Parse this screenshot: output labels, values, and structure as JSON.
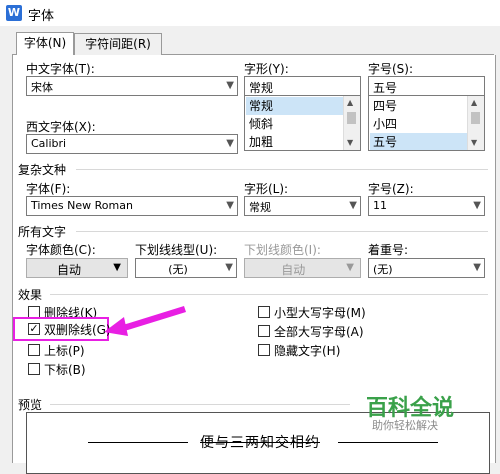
{
  "window": {
    "title": "字体",
    "app_icon": "W"
  },
  "tabs": [
    {
      "label": "字体(N)"
    },
    {
      "label": "字符间距(R)"
    }
  ],
  "chinese_font": {
    "label": "中文字体(T):",
    "value": "宋体"
  },
  "western_font": {
    "label": "西文字体(X):",
    "value": "Calibri"
  },
  "style": {
    "label": "字形(Y):",
    "value": "常规",
    "options": [
      "常规",
      "倾斜",
      "加粗"
    ],
    "selected": "常规"
  },
  "size": {
    "label": "字号(S):",
    "value": "五号",
    "options": [
      "四号",
      "小四",
      "五号"
    ],
    "selected": "五号"
  },
  "complex": {
    "heading": "复杂文种",
    "font_label": "字体(F):",
    "font_value": "Times New Roman",
    "style_label": "字形(L):",
    "style_value": "常规",
    "size_label": "字号(Z):",
    "size_value": "11"
  },
  "all_text": {
    "heading": "所有文字",
    "font_color_label": "字体颜色(C):",
    "font_color_value": "自动",
    "underline_type_label": "下划线线型(U):",
    "underline_type_value": "(无)",
    "underline_color_label": "下划线颜色(I):",
    "underline_color_value": "自动",
    "emphasis_label": "着重号:",
    "emphasis_value": "(无)"
  },
  "effects": {
    "heading": "效果",
    "strikethrough": {
      "label": "删除线(K)",
      "checked": false
    },
    "double_strikethrough": {
      "label": "双删除线(G)",
      "checked": true
    },
    "superscript": {
      "label": "上标(P)",
      "checked": false
    },
    "subscript": {
      "label": "下标(B)",
      "checked": false
    },
    "small_caps": {
      "label": "小型大写字母(M)",
      "checked": false
    },
    "all_caps": {
      "label": "全部大写字母(A)",
      "checked": false
    },
    "hidden": {
      "label": "隐藏文字(H)",
      "checked": false
    }
  },
  "preview": {
    "heading": "预览",
    "text": "便与三两知交相约"
  },
  "watermark": {
    "main": "百科全说",
    "sub": "助你轻松解决"
  },
  "colors": {
    "highlight": "#e81fe3",
    "selection": "#cce4f7",
    "watermark": "#3aa14a"
  }
}
